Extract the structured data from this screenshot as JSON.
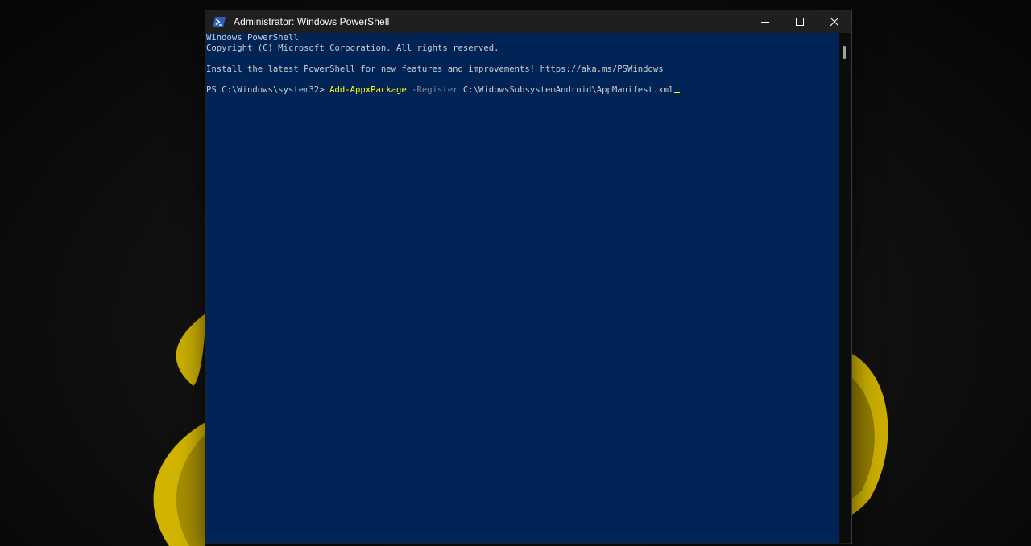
{
  "window": {
    "title": "Administrator: Windows PowerShell",
    "icon": "powershell-icon",
    "controls": [
      "minimize-icon",
      "maximize-icon",
      "close-icon"
    ]
  },
  "console": {
    "background": "#012456",
    "text_color": "#cccccc",
    "lines": {
      "header": "Windows PowerShell",
      "copyright": "Copyright (C) Microsoft Corporation. All rights reserved.",
      "install": "Install the latest PowerShell for new features and improvements! https://aka.ms/PSWindows"
    },
    "prompt": {
      "path": "PS C:\\Windows\\system32> ",
      "command": "Add-AppxPackage",
      "parameter": " -Register ",
      "argument": "C:\\WidowsSubsystemAndroid\\AppManifest.xml"
    },
    "colors": {
      "command": "#ffff00",
      "parameter": "#8a8a8a"
    }
  },
  "wallpaper": {
    "accent": "#d4b800"
  }
}
